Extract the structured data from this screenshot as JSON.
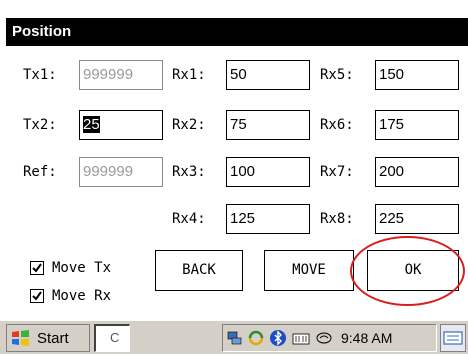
{
  "window": {
    "title": "Position"
  },
  "fields": {
    "tx1": {
      "label": "Tx1:",
      "value": "999999"
    },
    "tx2": {
      "label": "Tx2:",
      "value": "25"
    },
    "ref": {
      "label": "Ref:",
      "value": "999999"
    },
    "rx1": {
      "label": "Rx1:",
      "value": "50"
    },
    "rx2": {
      "label": "Rx2:",
      "value": "75"
    },
    "rx3": {
      "label": "Rx3:",
      "value": "100"
    },
    "rx4": {
      "label": "Rx4:",
      "value": "125"
    },
    "rx5": {
      "label": "Rx5:",
      "value": "150"
    },
    "rx6": {
      "label": "Rx6:",
      "value": "175"
    },
    "rx7": {
      "label": "Rx7:",
      "value": "200"
    },
    "rx8": {
      "label": "Rx8:",
      "value": "225"
    }
  },
  "checkboxes": {
    "move_tx": {
      "label": "Move Tx",
      "checked": true
    },
    "move_rx": {
      "label": "Move Rx",
      "checked": true
    }
  },
  "buttons": {
    "back": "BACK",
    "move": "MOVE",
    "ok": "OK"
  },
  "taskbar": {
    "start": "Start",
    "task": "C",
    "clock": "9:48 AM"
  },
  "colors": {
    "titlebar": "#000000",
    "highlight_ring": "#d62020",
    "taskbar": "#d4d0c8"
  }
}
